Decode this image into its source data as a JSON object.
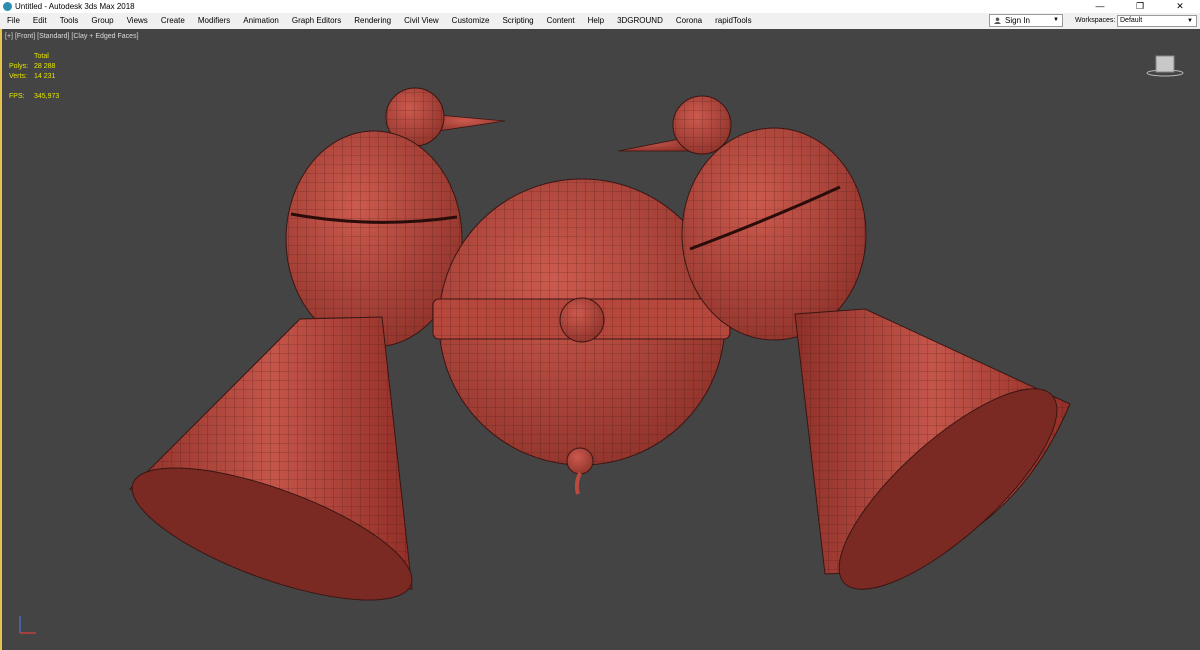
{
  "titlebar": {
    "title": "Untitled - Autodesk 3ds Max 2018",
    "icon": "3ds-max-icon",
    "controls": [
      "—",
      "❐",
      "✕"
    ]
  },
  "menubar": {
    "items": [
      "File",
      "Edit",
      "Tools",
      "Group",
      "Views",
      "Create",
      "Modifiers",
      "Animation",
      "Graph Editors",
      "Rendering",
      "Civil View",
      "Customize",
      "Scripting",
      "Content",
      "Help",
      "3DGROUND",
      "Corona",
      "rapidTools"
    ],
    "sign_in": "Sign In",
    "workspaces_label": "Workspaces:",
    "workspace_value": "Default"
  },
  "viewport": {
    "labels": [
      "[+]",
      "[Front]",
      "[Standard]",
      "[Clay + Edged Faces]"
    ],
    "stats": {
      "header": "Total",
      "polys_label": "Polys:",
      "polys_value": "28 288",
      "verts_label": "Verts:",
      "verts_value": "14 231",
      "fps_label": "FPS:",
      "fps_value": "345,973"
    },
    "viewcube_icon": "viewcube-icon",
    "colors": {
      "model": "#b84a40",
      "wire": "#3a1512",
      "background": "#444444",
      "active_border": "#e8c44a",
      "stats": "#e6e600"
    }
  }
}
